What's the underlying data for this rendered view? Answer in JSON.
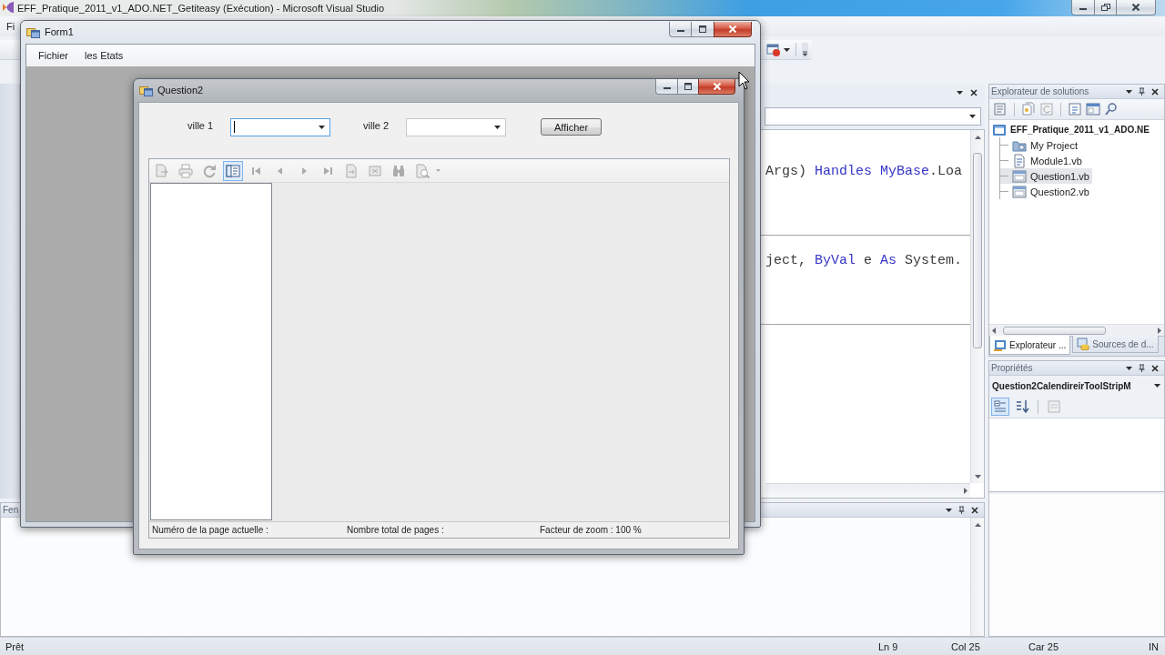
{
  "ide": {
    "title": "EFF_Pratique_2011_v1_ADO.NET_Getiteasy (Exécution) - Microsoft Visual Studio",
    "active": false,
    "menu": [
      "Fi"
    ]
  },
  "editor": {
    "lines": [
      {
        "segments": [
          {
            "text": "Args) ",
            "kind": "plain"
          },
          {
            "text": "Handles MyBase",
            "kind": "keyword"
          },
          {
            "text": ".Loa",
            "kind": "plain"
          }
        ]
      },
      {
        "segments": [
          {
            "text": "ject, ",
            "kind": "plain"
          },
          {
            "text": "ByVal",
            "kind": "keyword"
          },
          {
            "text": " e ",
            "kind": "plain"
          },
          {
            "text": "As",
            "kind": "keyword"
          },
          {
            "text": " System.",
            "kind": "plain"
          }
        ]
      }
    ]
  },
  "output_panel": {
    "title": "Fen"
  },
  "solution_explorer": {
    "title": "Explorateur de solutions",
    "tree": [
      {
        "label": "EFF_Pratique_2011_v1_ADO.NE",
        "kind": "solution",
        "selected": false,
        "children": [
          {
            "label": "My Project",
            "kind": "project",
            "selected": false
          },
          {
            "label": "Module1.vb",
            "kind": "module",
            "selected": false
          },
          {
            "label": "Question1.vb",
            "kind": "form",
            "selected": true
          },
          {
            "label": "Question2.vb",
            "kind": "form",
            "selected": false
          }
        ]
      }
    ],
    "tabs": [
      {
        "label": "Explorateur ...",
        "kind": "explorer",
        "selected": true
      },
      {
        "label": "Sources de d...",
        "kind": "data",
        "selected": false
      }
    ]
  },
  "properties": {
    "title": "Propriétés",
    "object": "Question2CalendireirToolStripM",
    "views": [
      {
        "kind": "categorized",
        "selected": true
      },
      {
        "kind": "alphabetical",
        "selected": false
      },
      {
        "kind": "pages",
        "selected": false
      }
    ]
  },
  "status_bar": {
    "message": "Prêt",
    "fields": [
      "Ln 9",
      "Col 25",
      "Car 25",
      "IN"
    ]
  },
  "form1": {
    "title": "Form1",
    "active": true,
    "menu": [
      "Fichier",
      "les Etats"
    ]
  },
  "question2": {
    "title": "Question2",
    "active": true,
    "fields": [
      {
        "label": "ville 1",
        "focused": true
      },
      {
        "label": "ville 2",
        "focused": false
      }
    ],
    "button": "Afficher",
    "viewer": {
      "tools": [
        {
          "kind": "export",
          "disabled": true,
          "selected": false
        },
        {
          "kind": "print",
          "disabled": true,
          "selected": false
        },
        {
          "kind": "refresh",
          "disabled": true,
          "selected": false
        },
        {
          "kind": "group-tree",
          "disabled": false,
          "selected": true
        },
        {
          "kind": "first",
          "disabled": true,
          "selected": false
        },
        {
          "kind": "previous",
          "disabled": true,
          "selected": false
        },
        {
          "kind": "next",
          "disabled": true,
          "selected": false
        },
        {
          "kind": "last",
          "disabled": true,
          "selected": false
        },
        {
          "kind": "goto",
          "disabled": true,
          "selected": false
        },
        {
          "kind": "close-view",
          "disabled": true,
          "selected": false
        },
        {
          "kind": "find",
          "disabled": true,
          "selected": false
        },
        {
          "kind": "zoom",
          "disabled": true,
          "selected": false
        }
      ],
      "status": [
        "Numéro de la page actuelle :",
        "Nombre total de pages :",
        "Facteur de zoom : 100 %"
      ]
    }
  }
}
